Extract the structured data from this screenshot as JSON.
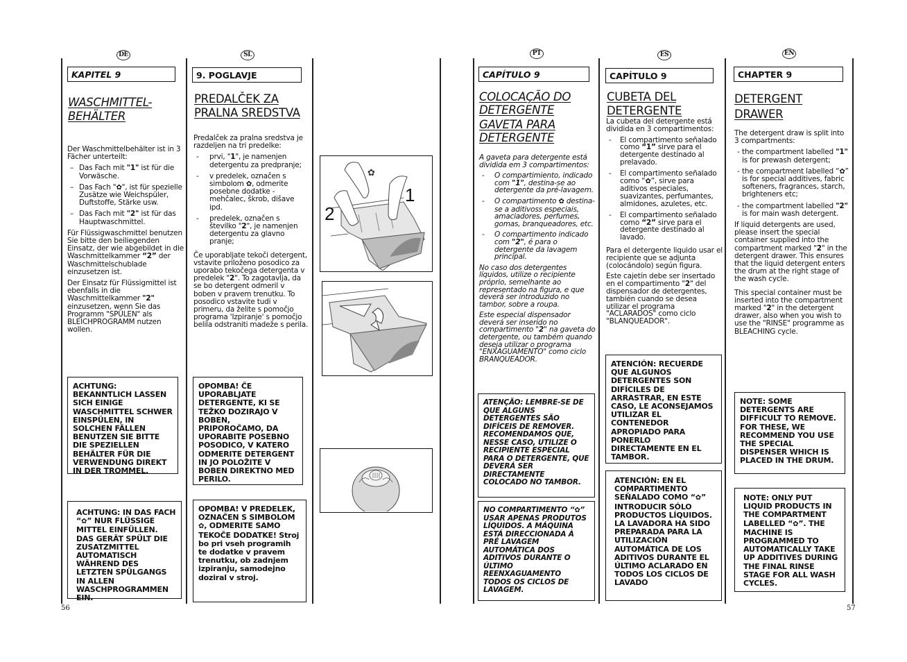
{
  "page_numbers": {
    "left": "56",
    "right": "57"
  },
  "flower_symbol": "✿",
  "columns": {
    "de": {
      "lang": "DE",
      "chapter": "KAPITEL 9",
      "title_lines": [
        "WASCHMITTEL-",
        "BEHÄLTER"
      ],
      "intro": "Der Waschmittelbehälter ist in 3 Fächer unterteilt:",
      "items": [
        {
          "pre": "Das Fach mit ",
          "bold": "\"1\"",
          "post": " ist für die Vorwäsche."
        },
        {
          "pre": "Das Fach \"",
          "sym": "✿",
          "post": "\", ist für spezielle Zusätze wie Weichspüler, Duftstoffe, Stärke usw."
        },
        {
          "pre": "Das Fach mit ",
          "bold": "\"2\"",
          "post": " ist für das Hauptwaschmittel."
        }
      ],
      "para1": {
        "pre": "Für Flüssigwaschmittel benutzen Sie bitte den beiliegenden Einsatz, der wie abgebildet in die Waschmittelkammer ",
        "bold": "“2”",
        "post": " der Waschmittelschublade einzusetzen ist."
      },
      "para2": {
        "pre": "Der Einsatz  für Flüssigmittel ist ebenfalls in die Waschmittelkammer ",
        "bold": "\"2\"",
        "post": " einzusetzen, wenn Sie das Programm \"SPÜLEN\" als BLEICHPROGRAMM nutzen wollen."
      },
      "note1": "ACHTUNG: BEKANNTLICH LASSEN SICH EINIGE WASCHMITTEL SCHWER EINSPÜLEN, IN SOLCHEN FÄLLEN BENUTZEN SIE BITTE DIE SPEZIELLEN BEHÄLTER FÜR DIE VERWENDUNG DIREKT IN DER TROMMEL.",
      "note2": {
        "pre": "ACHTUNG: IN DAS FACH “",
        "sym": "✿",
        "post": "” NUR FLÜSSIGE MITTEL EINFÜLLEN. DAS GERÄT SPÜLT DIE ZUSATZMITTEL AUTOMATISCH WÄHREND DES LETZTEN SPÜLGANGS IN ALLEN WASCHPROGRAMMEN EIN."
      }
    },
    "sl": {
      "lang": "SL",
      "chapter": "9. POGLAVJE",
      "title_lines": [
        "PREDALČEK ZA",
        "PRALNA SREDSTVA"
      ],
      "intro": "Predalček za pralna sredstva je razdeljen na tri predelke:",
      "items": [
        {
          "pre": "prvi, \"",
          "bold": "1",
          "post": "\", je namenjen detergentu za predpranje;"
        },
        {
          "pre": "v predelek, označen s simbolom ",
          "sym": "✿",
          "post": ", odmerite posebne dodatke - mehčalec, škrob, dišave ipd."
        },
        {
          "pre": "predelek, označen s številko \"",
          "bold": "2",
          "post": "\", je namenjen detergentu za glavno pranje;"
        }
      ],
      "para1": {
        "pre": "Če uporabljate tekoči detergent, vstavite priloženo posodico za uporabo tekočega detergenta v predelek \"",
        "bold": "2",
        "post": "\". To zagotavlja, da se bo detergent odmeril v boben v pravem trenutku. To posodico vstavite tudi v primeru, da želite s pomočjo programa 'Izpiranje' s pomočjo belila odstraniti madeže s perila."
      },
      "note1": "OPOMBA! ČE UPORABLJATE DETERGENTE, KI SE TEŽKO DOZIRAJO V BOBEN, PRIPOROČAMO, DA UPORABITE POSEBNO POSODICO, V KATERO ODMERITE DETERGENT IN JO POLOŽITE V BOBEN DIREKTNO MED PERILO.",
      "note2": {
        "pre": "OPOMBA! V PREDELEK, OZNAČEN S SIMBOLOM ",
        "sym": "✿",
        "post": ", ODMERITE SAMO TEKOČE DODATKE! Stroj bo pri vseh programih te dodatke v pravem trenutku, ob zadnjem izpiranju, samodejno doziral v stroj."
      }
    },
    "figures": {
      "fig1_labels": [
        "1",
        "2"
      ],
      "fig1_symbol": "✿"
    },
    "pt": {
      "lang": "PT",
      "chapter": "CAPÍTULO 9",
      "title_lines": [
        "COLOCAÇÃO DO",
        "DETERGENTE",
        "GAVETA PARA",
        "DETERGENTE"
      ],
      "intro": "A gaveta para detergente está dividida em 3 compartimentos:",
      "items": [
        {
          "pre": "O compartimiento, indicado com ",
          "bold": "\"1\"",
          "post": ", destina-se ao detergente da pré-lavagem."
        },
        {
          "pre": "O compartimento ",
          "sym": "✿",
          "post": " destina-se a aditivoss especiais, amaciadores, perfumes, gomas, branqueadores, etc."
        },
        {
          "pre": "O compartimento indicado com ",
          "bold": "\"2\"",
          "post": ", é para o detergente da lavagem principal."
        }
      ],
      "para1": {
        "pre": "No caso dos detergentes líquidos, utilize o recipiente próprio, semelhante ao representado na figura, e que deverá ser introduzido no tambor, sobre a roupa.",
        "bold": "",
        "post": ""
      },
      "para2": {
        "pre": "Este especial dispensador deverá ser inserido no compartimento \"",
        "bold": "2",
        "post": "\" na gaveta do detergente, ou também quando deseja utilizar o programa \"ENXAGUAMENTO\" como ciclo BRANQUEADOR."
      },
      "note1": "ATENÇÃO: LEMBRE-SE DE QUE ALGUNS DETERGENTES SÃO DIFÍCEIS DE REMOVER. RECOMENDAMOS QUE, NESSE CASO, UTILIZE O RECIPIENTE ESPECIAL PARA O DETERGENTE, QUE DEVERÁ SER DIRECTAMENTE COLOCADO NO TAMBOR.",
      "note2": {
        "pre": "NO COMPARTIMENTO “",
        "sym": "✿",
        "post": "” USAR APENAS PRODUTOS LÍQUIDOS. A MÁQUINA ESTÁ DIRECCIONADA À PRÉ LAVAGEM AUTOMÁTICA DOS ADITIVOS DURANTE O ÚLTIMO REENXAGUAMENTO TODOS OS CICLOS DE LAVAGEM."
      }
    },
    "es": {
      "lang": "ES",
      "chapter": "CAPÍTULO 9",
      "title_lines": [
        "CUBETA DEL",
        "DETERGENTE"
      ],
      "intro": "La cubeta del detergente está dividida en 3 compartimentos:",
      "items": [
        {
          "pre": "El compartimento señalado como ",
          "bold": "“1”",
          "post": " sirve para el detergente destinado al prelavado."
        },
        {
          "pre": "El compartimento señalado como “",
          "sym": "✿",
          "post": "”, sirve para aditivos especiales, suavizantes, perfumantes, almidones, azuletes, etc."
        },
        {
          "pre": "El compartimento señalado como ",
          "bold": "“2”",
          "post": " sirve para el detergente destinado al lavado."
        }
      ],
      "para1": {
        "pre": "Para el detergente liquido usar el recipiente que se adjunta (colocándolo) según figura.",
        "bold": "",
        "post": ""
      },
      "para2": {
        "pre": "Este cajetín debe ser insertado en el compartimento \"",
        "bold": "2",
        "post": "\" del dispensador de detergentes, también cuando se desea utilizar el programa \"ACLARADOS\" como ciclo \"BLANQUEADOR\"."
      },
      "note1": "ATENCIÓN: RECUERDE QUE ALGUNOS DETERGENTES SON DIFÍCILES DE ARRASTRAR, EN ESTE CASO, LE ACONSEJAMOS UTILIZAR EL CONTENEDOR APROPIADO PARA PONERLO DIRECTAMENTE EN EL TAMBOR.",
      "note2": {
        "pre": "ATENCIÓN: EN EL COMPARTIMENTO SEÑALADO COMO “",
        "sym": "✿",
        "post": "” INTRODUCIR SÓLO PRODUCTOS LÍQUIDOS. LA LAVADORA HA SIDO PREPARADA PARA LA UTILIZACIÓN AUTOMÁTICA DE LOS ADITIVOS DURANTE EL ÚLTIMO ACLARADO EN TODOS LOS CICLOS DE LAVADO"
      }
    },
    "en": {
      "lang": "EN",
      "chapter": "CHAPTER 9",
      "title_lines": [
        "DETERGENT",
        "DRAWER"
      ],
      "intro": "The detergent draw is split into 3 compartments:",
      "items": [
        {
          "pre": "the compartment labelled ",
          "bold": "\"1\"",
          "post": " is for prewash detergent;"
        },
        {
          "pre": "the compartment labelled “",
          "sym": "✿",
          "post": "” is for special additives, fabric softeners, fragrances, starch, brighteners etc;"
        },
        {
          "pre": "the compartment labelled ",
          "bold": "\"2\"",
          "post": " is for main wash detergent."
        }
      ],
      "para1": {
        "pre": "If liquid detergents are used, please insert the special container supplied into the compartment marked \"",
        "bold": "2",
        "post": "\" in the detergent drawer. This ensures that the liquid detergent enters the drum at the right stage of the wash cycle."
      },
      "para2": {
        "pre": "This special container must be inserted into the compartment marked \"",
        "bold": "2",
        "post": "\" in the detergent drawer, also when you wish to use the \"RINSE\" programme as BLEACHING cycle."
      },
      "note1": "NOTE: SOME DETERGENTS ARE DIFFICULT TO REMOVE. FOR THESE, WE RECOMMEND YOU USE THE SPECIAL DISPENSER WHICH IS PLACED IN THE DRUM.",
      "note2": {
        "pre": "NOTE: ONLY PUT LIQUID PRODUCTS IN THE COMPARTMENT LABELLED “",
        "sym": "✿",
        "post": "”. THE MACHINE IS PROGRAMMED TO AUTOMATICALLY TAKE UP ADDITIVES DURING THE FINAL RINSE STAGE FOR ALL WASH CYCLES."
      }
    }
  }
}
